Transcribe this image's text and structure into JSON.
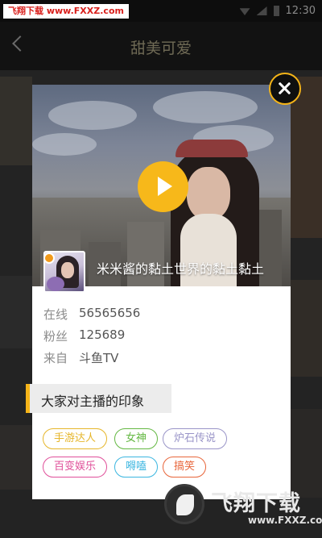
{
  "status_bar": {
    "watermark": "飞翔下载 www.FXXZ.com",
    "time": "12:30",
    "icons": [
      "wifi-icon",
      "signal-icon",
      "battery-icon"
    ]
  },
  "header": {
    "title": "甜美可爱",
    "back_icon": "chevron-left-icon"
  },
  "modal": {
    "streamer_name": "米米酱的黏土世界的黏土黏土",
    "play_icon": "play-icon",
    "close_icon": "close-icon",
    "info": [
      {
        "label": "在线",
        "value": "56565656"
      },
      {
        "label": "粉丝",
        "value": "125689"
      },
      {
        "label": "来自",
        "value": "斗鱼TV"
      }
    ],
    "impression_title": "大家对主播的印象",
    "tags": [
      {
        "label": "手游达人",
        "color": "#e6b62b"
      },
      {
        "label": "女神",
        "color": "#64b843"
      },
      {
        "label": "炉石传说",
        "color": "#9a95c8"
      },
      {
        "label": "百变娱乐",
        "color": "#e0509a"
      },
      {
        "label": "嘚嗑",
        "color": "#3bb6e0"
      },
      {
        "label": "搞笑",
        "color": "#e8663b"
      }
    ]
  },
  "watermark_bottom": {
    "text": "飞翔下载",
    "domain": "www.FXXZ.com"
  },
  "colors": {
    "accent": "#f5b418"
  }
}
